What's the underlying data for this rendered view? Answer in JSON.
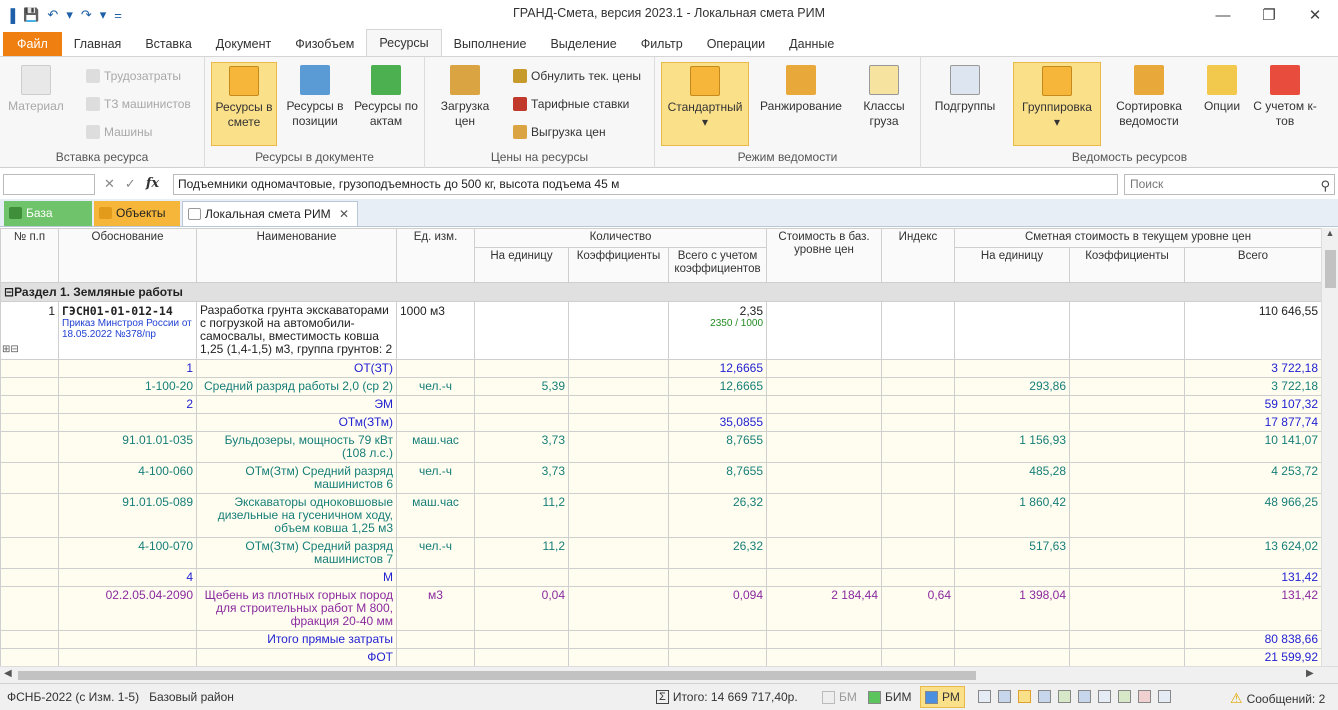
{
  "app": {
    "title": "ГРАНД-Смета, версия 2023.1 - Локальная смета РИМ"
  },
  "qat": [
    "▐",
    "💾",
    "↶",
    "▾",
    "↷",
    "▾",
    "="
  ],
  "window": {
    "min": "—",
    "max": "❐",
    "close": "✕"
  },
  "menu": {
    "tabs": [
      "Файл",
      "Главная",
      "Вставка",
      "Документ",
      "Физобъем",
      "Ресурсы",
      "Выполнение",
      "Выделение",
      "Фильтр",
      "Операции",
      "Данные"
    ],
    "active": "Ресурсы"
  },
  "ribbon": {
    "g1": {
      "title": "Вставка ресурса",
      "material": "Материал",
      "trud": "Трудозатраты",
      "tz": "ТЗ машинистов",
      "mash": "Машины"
    },
    "g2": {
      "title": "Ресурсы в документе",
      "b1": "Ресурсы в смете",
      "b2": "Ресурсы в позиции",
      "b3": "Ресурсы по актам"
    },
    "g3": {
      "title": "Цены на ресурсы",
      "load": "Загрузка цен",
      "reset": "Обнулить тек. цены",
      "tarif": "Тарифные ставки",
      "unload": "Выгрузка цен"
    },
    "g4": {
      "title": "Режим ведомости",
      "std": "Стандартный",
      "rank": "Ранжирование",
      "cls": "Классы груза"
    },
    "g5": {
      "title": "Ведомость ресурсов",
      "sub": "Подгруппы",
      "grp": "Группировка",
      "sort": "Сортировка ведомости",
      "opt": "Опции",
      "k": "С учетом к-тов"
    }
  },
  "formula": {
    "value": "Подъемники одномачтовые, грузоподъемность до 500 кг, высота подъема 45 м",
    "search_placeholder": "Поиск"
  },
  "doctabs": {
    "base": "База",
    "objects": "Объекты",
    "local": "Локальная смета РИМ",
    "close": "✕"
  },
  "table": {
    "headers": {
      "num": "№ п.п",
      "basis": "Обоснование",
      "name": "Наименование",
      "unit": "Ед. изм.",
      "qty": "Количество",
      "per_unit": "На единицу",
      "coeff": "Коэффициенты",
      "total_coeff": "Всего с учетом коэффициентов",
      "base_cost": "Стоимость в баз. уровне цен",
      "index": "Индекс",
      "cur_cost": "Сметная стоимость в текущем уровне цен",
      "cur_unit": "На единицу",
      "cur_coeff": "Коэффициенты",
      "cur_total": "Всего"
    },
    "section": "Раздел 1. Земляные работы",
    "pos": {
      "num": "1",
      "code": "ГЭСН01-01-012-14",
      "order": "Приказ Минстроя России от 18.05.2022 №378/пр",
      "name": "Разработка грунта экскаваторами с погрузкой на автомобили-самосвалы, вместимость ковша 1,25 (1,4-1,5) м3, группа грунтов: 2",
      "unit": "1000 м3",
      "qty": "2,35",
      "qtyformula": "2350 / 1000",
      "total": "110 646,55",
      "toggles": "⊞⊟"
    },
    "rows": [
      {
        "cls": "blue",
        "b": "1",
        "n": "ОТ(ЗТ)",
        "u": "",
        "q": "",
        "t": "12,6665",
        "bc": "",
        "ix": "",
        "cu": "",
        "ct": "3 722,18"
      },
      {
        "cls": "teal",
        "b": "1-100-20",
        "n": "Средний разряд работы 2,0 (ср 2)",
        "u": "чел.-ч",
        "q": "5,39",
        "t": "12,6665",
        "bc": "",
        "ix": "",
        "cu": "293,86",
        "ct": "3 722,18"
      },
      {
        "cls": "blue",
        "b": "2",
        "n": "ЭМ",
        "u": "",
        "q": "",
        "t": "",
        "bc": "",
        "ix": "",
        "cu": "",
        "ct": "59 107,32"
      },
      {
        "cls": "blue",
        "b": "",
        "n": "ОТм(ЗТм)",
        "u": "",
        "q": "",
        "t": "35,0855",
        "bc": "",
        "ix": "",
        "cu": "",
        "ct": "17 877,74"
      },
      {
        "cls": "teal",
        "b": "91.01.01-035",
        "n": "Бульдозеры, мощность 79 кВт (108 л.с.)",
        "u": "маш.час",
        "q": "3,73",
        "t": "8,7655",
        "bc": "",
        "ix": "",
        "cu": "1 156,93",
        "ct": "10 141,07"
      },
      {
        "cls": "teal",
        "b": "4-100-060",
        "n": "ОТм(Зтм) Средний разряд машинистов 6",
        "u": "чел.-ч",
        "q": "3,73",
        "t": "8,7655",
        "bc": "",
        "ix": "",
        "cu": "485,28",
        "ct": "4 253,72"
      },
      {
        "cls": "teal",
        "b": "91.01.05-089",
        "n": "Экскаваторы одноковшовые дизельные на гусеничном ходу, объем ковша 1,25 м3",
        "u": "маш.час",
        "q": "11,2",
        "t": "26,32",
        "bc": "",
        "ix": "",
        "cu": "1 860,42",
        "ct": "48 966,25"
      },
      {
        "cls": "teal",
        "b": "4-100-070",
        "n": "ОТм(Зтм) Средний разряд машинистов 7",
        "u": "чел.-ч",
        "q": "11,2",
        "t": "26,32",
        "bc": "",
        "ix": "",
        "cu": "517,63",
        "ct": "13 624,02"
      },
      {
        "cls": "blue",
        "b": "4",
        "n": "М",
        "u": "",
        "q": "",
        "t": "",
        "bc": "",
        "ix": "",
        "cu": "",
        "ct": "131,42"
      },
      {
        "cls": "purple",
        "b": "02.2.05.04-2090",
        "n": "Щебень из плотных горных пород для строительных работ М 800, фракция 20-40 мм",
        "u": "м3",
        "q": "0,04",
        "t": "0,094",
        "bc": "2 184,44",
        "ix": "0,64",
        "cu": "1 398,04",
        "ct": "131,42"
      },
      {
        "cls": "blue",
        "b": "",
        "n": "Итого прямые затраты",
        "u": "",
        "q": "",
        "t": "",
        "bc": "",
        "ix": "",
        "cu": "",
        "ct": "80 838,66"
      },
      {
        "cls": "blue",
        "b": "",
        "n": "ФОТ",
        "u": "",
        "q": "",
        "t": "",
        "bc": "",
        "ix": "",
        "cu": "",
        "ct": "21 599,92"
      }
    ]
  },
  "status": {
    "norm": "ФСНБ-2022 (с Изм. 1-5)",
    "region": "Базовый район",
    "sum_icon": "Σ",
    "total": "Итого: 14 669 717,40р.",
    "bm": "БМ",
    "bim": "БИМ",
    "rm": "РМ",
    "msgs": "Сообщений: 2",
    "warn": "⚠"
  },
  "colors": {
    "file_tab": "#f07f12",
    "selected_button": "#fbe08a",
    "blue_text": "#1f1fd1",
    "teal_text": "#167e78",
    "purple_text": "#8a2a9e"
  }
}
